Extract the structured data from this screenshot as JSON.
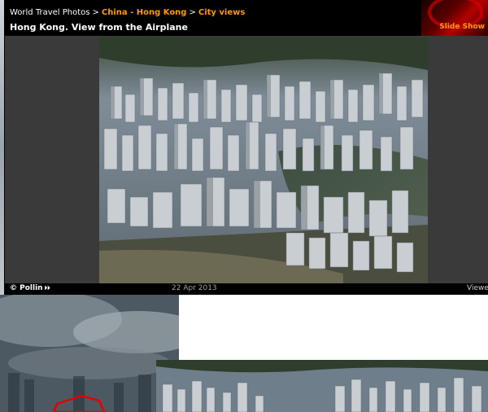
{
  "header": {
    "breadcrumb_root": "World Travel Photos",
    "breadcrumb_separator": ">",
    "breadcrumb_country": "China - Hong Kong",
    "breadcrumb_category": "City views",
    "photo_title": "Hong Kong. View from the Airplane",
    "slideshow_label": "Slide Show"
  },
  "footer": {
    "author": "© Pollin",
    "author_arrows": "⏵⏵",
    "date": "22 Apr 2013",
    "viewed_label": "Viewe"
  },
  "colors": {
    "background": "#000000",
    "panel": "#3a3a3a",
    "link_accent": "#ff9900",
    "annotation_red": "#e60000"
  }
}
